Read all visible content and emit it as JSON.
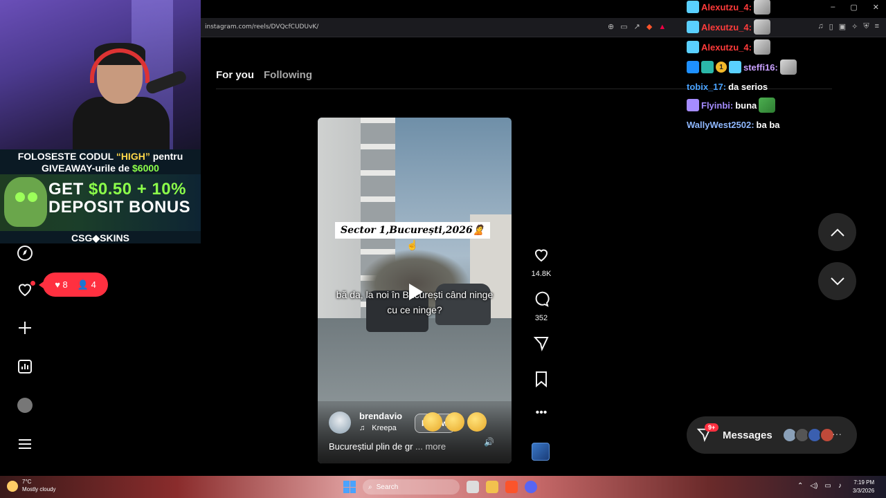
{
  "browser": {
    "url": "instagram.com/reels/DVQcfCUDUvK/",
    "window_controls": [
      "–",
      "▢",
      "✕"
    ]
  },
  "feed_tabs": {
    "for_you": "For you",
    "following": "Following"
  },
  "webcam_promo": {
    "line1_prefix": "FOLOSESTE CODUL ",
    "line1_code": "“HIGH”",
    "line1_suffix": " pentru",
    "line2_prefix": "GIVEAWAY-urile de ",
    "line2_amount": "$6000",
    "big1_prefix": "GET ",
    "big1_amount": "$0.50 + 10%",
    "big2": "DEPOSIT BONUS",
    "brand": "CSG◆SKINS"
  },
  "notifications": {
    "likes": "8",
    "follows": "4"
  },
  "reel": {
    "title_overlay": "Sector 1,București,2026🙎",
    "caption_line1": "bă da, la noi în București când ninge",
    "caption_line2": "cu ce ninge?",
    "author": "brendavio",
    "music": "Kreepa",
    "follow_label": "Follow",
    "description": "Bucureștiul plin de gr",
    "more": " ... more"
  },
  "actions": {
    "likes": "14.8K",
    "comments": "352"
  },
  "messages": {
    "label": "Messages",
    "badge": "9+",
    "more": "···"
  },
  "chat": [
    {
      "user": "Alexutzu_4:",
      "msg": "",
      "color": "#ff3b3b"
    },
    {
      "user": "Alexutzu_4:",
      "msg": "",
      "color": "#ff3b3b"
    },
    {
      "user": "Alexutzu_4:",
      "msg": "",
      "color": "#ff3b3b"
    },
    {
      "user": "steffi16:",
      "msg": "",
      "color": "#c9a0ff"
    },
    {
      "user": "tobix_17:",
      "msg": "da serios",
      "color": "#4aa3ff"
    },
    {
      "user": "Flyinbi:",
      "msg": "buna",
      "color": "#a58cff"
    },
    {
      "user": "WallyWest2502:",
      "msg": "ba ba",
      "color": "#8fb8ff"
    }
  ],
  "taskbar": {
    "temp": "7°C",
    "weather": "Mostly cloudy",
    "search": "Search",
    "time": "7:19 PM",
    "date": "3/3/2026"
  },
  "colors": {
    "notif_red": "#ff3040",
    "ig_dark": "#262626"
  }
}
